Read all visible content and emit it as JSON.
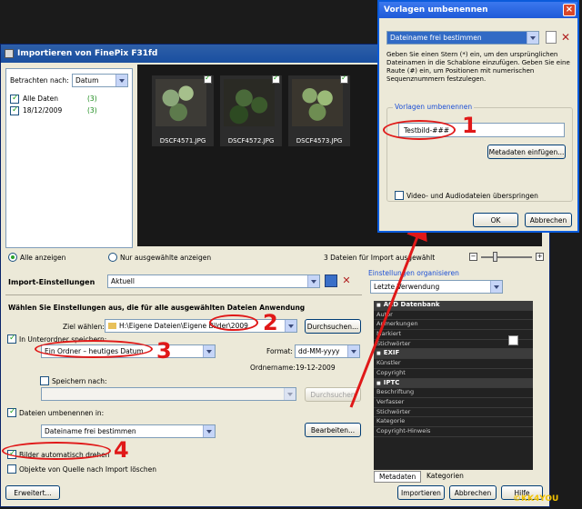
{
  "main": {
    "title": "Importieren von FinePix F31fd",
    "browse_label": "Betrachten nach:",
    "browse_value": "Datum",
    "tree": [
      {
        "label": "Alle Daten",
        "count": "(3)"
      },
      {
        "label": "18/12/2009",
        "count": "(3)"
      }
    ],
    "thumbs": [
      {
        "caption": "DSCF4571.JPG"
      },
      {
        "caption": "DSCF4572.JPG"
      },
      {
        "caption": "DSCF4573.JPG"
      }
    ],
    "show_all": "Alle anzeigen",
    "show_selected": "Nur ausgewählte anzeigen",
    "import_count": "3 Dateien für Import ausgewählt",
    "import_settings_label": "Import-Einstellungen",
    "import_settings_value": "Aktuell",
    "apply_heading": "Wählen Sie Einstellungen aus, die für alle ausgewählten Dateien Anwendung",
    "target_label": "Ziel wählen:",
    "target_value": "H:\\Eigene Dateien\\Eigene Bilder\\2009",
    "browse_btn": "Durchsuchen...",
    "subfolder_label": "In Unterordner speichern:",
    "subfolder_value": "Ein Ordner – heutiges Datum",
    "format_label": "Format:",
    "format_value": "dd-MM-yyyy",
    "foldername_label": "Ordnername:",
    "foldername_value": "19-12-2009",
    "save_to_label": "Speichern nach:",
    "browse_btn2": "Durchsuchen",
    "rename_label": "Dateien umbenennen in:",
    "rename_value": "Dateiname frei bestimmen",
    "edit_btn": "Bearbeiten...",
    "auto_rotate": "Bilder automatisch drehen",
    "delete_source": "Objekte von Quelle nach Import löschen",
    "advanced_btn": "Erweitert...",
    "import_btn": "Importieren",
    "cancel_btn": "Abbrechen",
    "help_btn": "Hilfe",
    "organize_label": "Einstellungen organisieren",
    "organize_value": "Letzte Verwendung",
    "meta_rows": [
      {
        "text": "ACD Datenbank",
        "head": true
      },
      {
        "text": "Autor",
        "head": false
      },
      {
        "text": "Anmerkungen",
        "head": false
      },
      {
        "text": "Markiert",
        "head": false
      },
      {
        "text": "Stichwörter",
        "head": false
      },
      {
        "text": "EXIF",
        "head": true
      },
      {
        "text": "Künstler",
        "head": false
      },
      {
        "text": "Copyright",
        "head": false
      },
      {
        "text": "IPTC",
        "head": true
      },
      {
        "text": "Beschriftung",
        "head": false
      },
      {
        "text": "Verfasser",
        "head": false
      },
      {
        "text": "Stichwörter",
        "head": false
      },
      {
        "text": "Kategorie",
        "head": false
      },
      {
        "text": "Copyright-Hinweis",
        "head": false
      }
    ],
    "tab_metadata": "Metadaten",
    "tab_categories": "Kategorien"
  },
  "dialog": {
    "title": "Vorlagen umbenennen",
    "template_combo": "Dateiname frei bestimmen",
    "help_text": "Geben Sie einen Stern (*) ein, um den ursprünglichen Dateinamen in die Schablone einzufügen. Geben Sie eine Raute (#) ein, um Positionen mit numerischen Sequenznummern festzulegen.",
    "group_title": "Vorlagen umbenennen",
    "template_value": "Testbild-###",
    "metadata_btn": "Metadaten einfügen...",
    "skip_video": "Video- und Audiodateien überspringen",
    "ok_btn": "OK",
    "cancel_btn": "Abbrechen"
  },
  "markers": [
    "1",
    "2",
    "3",
    "4"
  ],
  "watermark": "©KK4YOU",
  "colors": {
    "accent": "#e01818",
    "titlebar": "#1f5ad8"
  }
}
